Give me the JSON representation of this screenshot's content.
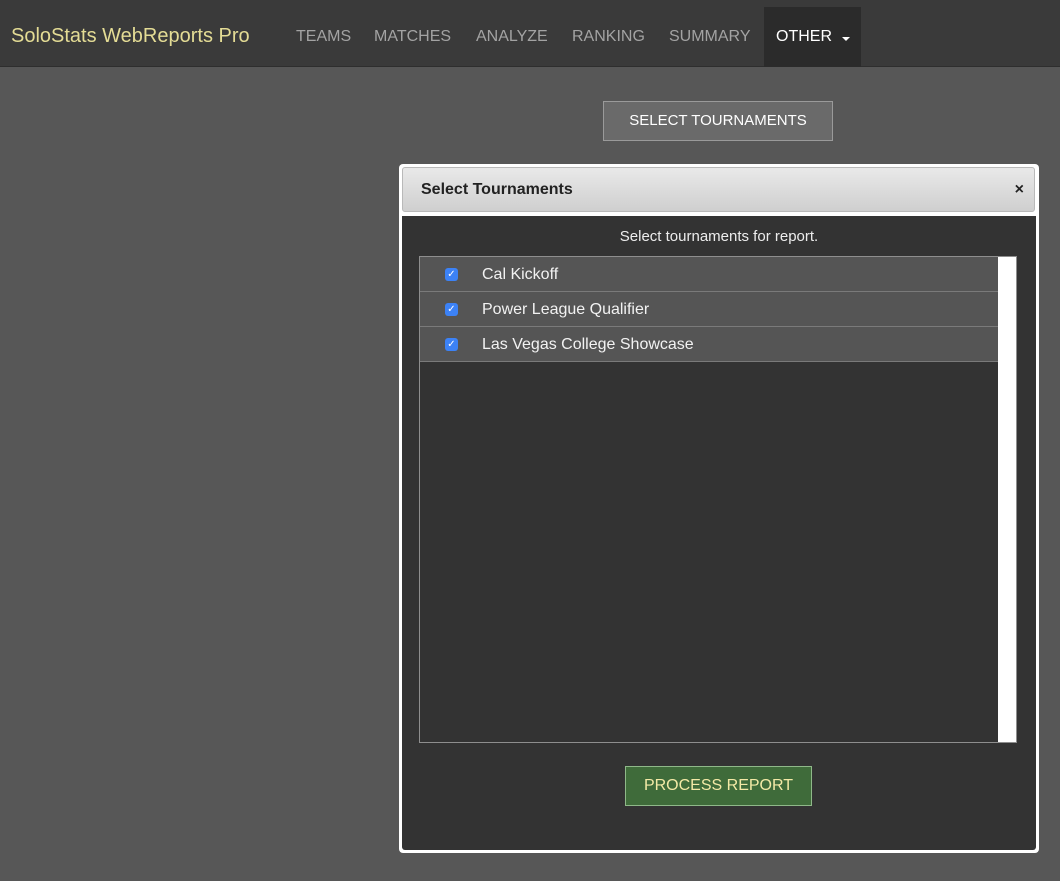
{
  "navbar": {
    "brand": "SoloStats WebReports Pro",
    "items": [
      {
        "label": "TEAMS"
      },
      {
        "label": "MATCHES"
      },
      {
        "label": "ANALYZE"
      },
      {
        "label": "RANKING"
      },
      {
        "label": "SUMMARY"
      }
    ],
    "active_dropdown": {
      "label": "OTHER",
      "icon": "caret-down-icon"
    }
  },
  "select_button_label": "SELECT TOURNAMENTS",
  "modal": {
    "title": "Select Tournaments",
    "close_symbol": "×",
    "instructions": "Select tournaments for report.",
    "tournaments": [
      {
        "name": "Cal Kickoff",
        "checked": true
      },
      {
        "name": "Power League Qualifier",
        "checked": true
      },
      {
        "name": "Las Vegas College Showcase",
        "checked": true
      }
    ],
    "process_button_label": "PROCESS REPORT"
  },
  "colors": {
    "brand": "#e4dc95",
    "navbar_bg": "#3a3a3a",
    "page_bg": "#575757",
    "modal_body_bg": "#333333",
    "checkbox_accent": "#3c82f6",
    "process_button_bg": "#3f6b3a",
    "process_button_text": "#f3e9a6"
  }
}
